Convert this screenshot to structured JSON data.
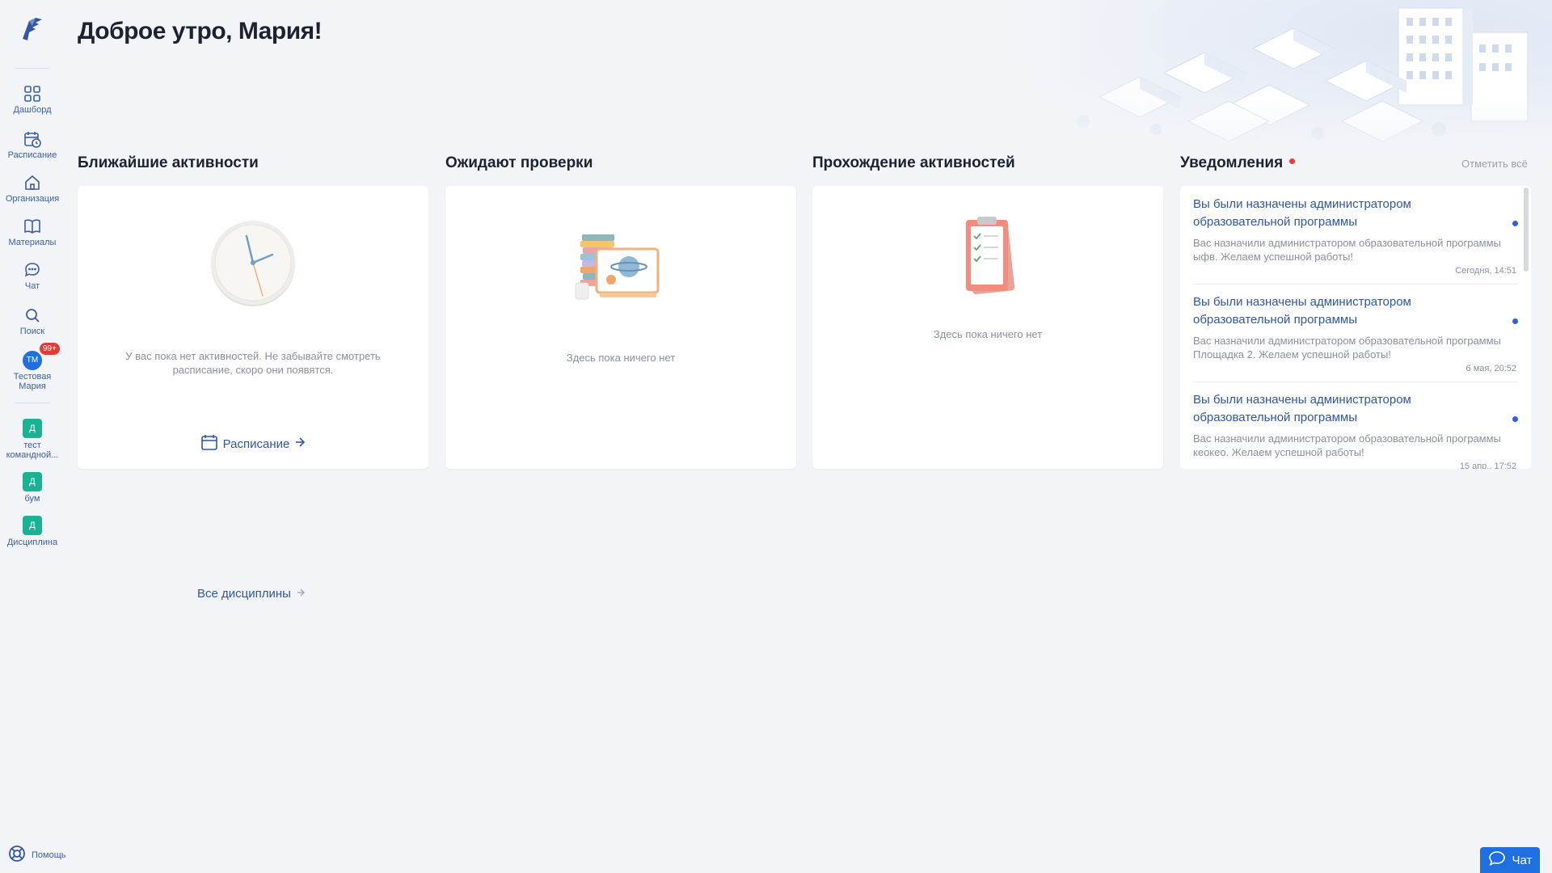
{
  "greeting": "Доброе утро, Мария!",
  "sidebar": {
    "items": [
      {
        "label": "Дашборд",
        "icon": "grid-icon"
      },
      {
        "label": "Расписание",
        "icon": "calendar-clock-icon"
      },
      {
        "label": "Организация",
        "icon": "home-icon"
      },
      {
        "label": "Материалы",
        "icon": "book-icon"
      },
      {
        "label": "Чат",
        "icon": "chat-bubble-icon"
      },
      {
        "label": "Поиск",
        "icon": "search-icon"
      }
    ],
    "profile": {
      "initials": "ТМ",
      "name": "Тестовая Мария",
      "badge": "99+"
    },
    "disciplines": [
      {
        "letter": "Д",
        "label": "тест командной..."
      },
      {
        "letter": "Д",
        "label": "бум"
      },
      {
        "letter": "Д",
        "label": "Дисциплина"
      }
    ],
    "help_label": "Помощь"
  },
  "sections": {
    "upcoming": {
      "title": "Ближайшие активности",
      "empty_text": "У вас пока нет активностей. Не забывайте смотреть расписание, скоро они появятся.",
      "link_label": "Расписание"
    },
    "review": {
      "title": "Ожидают проверки",
      "empty_text": "Здесь пока ничего нет"
    },
    "progress": {
      "title": "Прохождение активностей",
      "empty_text": "Здесь пока ничего нет"
    },
    "notifications": {
      "title": "Уведомления",
      "mark_all": "Отметить всё",
      "items": [
        {
          "title": "Вы были назначены администратором образовательной программы",
          "body": "Вас назначили администратором образовательной программы ыфв. Желаем успешной работы!",
          "time": "Сегодня, 14:51"
        },
        {
          "title": "Вы были назначены администратором образовательной программы",
          "body": "Вас назначили администратором образовательной программы Площадка 2. Желаем успешной работы!",
          "time": "6 мая, 20:52"
        },
        {
          "title": "Вы были назначены администратором образовательной программы",
          "body": "Вас назначили администратором образовательной программы кеокео. Желаем успешной работы!",
          "time": "15 апр., 17:52"
        }
      ]
    }
  },
  "all_disciplines": "Все дисциплины",
  "chat_button": "Чат",
  "colors": {
    "accent": "#2f57a4",
    "primary": "#1f6fe0",
    "discipline": "#19b394",
    "alert": "#ef3b3b"
  }
}
